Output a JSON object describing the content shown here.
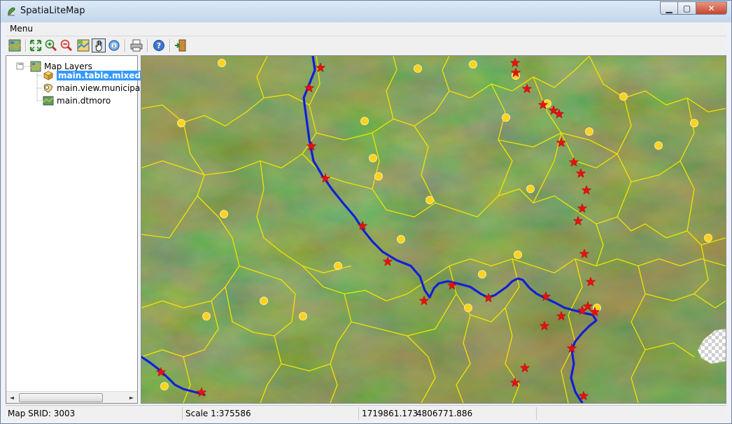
{
  "window": {
    "title": "SpatiaLiteMap",
    "min_glyph": "▁",
    "max_glyph": "▢",
    "close_glyph": "✕"
  },
  "menu": {
    "label": "Menu"
  },
  "toolbar": {
    "buttons": [
      {
        "name": "map-layers-icon"
      },
      {
        "name": "zoom-full-extent-icon"
      },
      {
        "name": "zoom-in-icon"
      },
      {
        "name": "zoom-out-icon"
      },
      {
        "name": "map-view-icon"
      },
      {
        "name": "pan-hand-icon",
        "active": true
      },
      {
        "name": "identify-icon"
      },
      {
        "name": "print-icon"
      },
      {
        "name": "help-icon"
      },
      {
        "name": "exit-icon"
      }
    ]
  },
  "tree": {
    "root_label": "Map Layers",
    "expander": "−",
    "layers": [
      {
        "label": "main.table.mixed",
        "selected": true
      },
      {
        "label": "main.view.municipal",
        "selected": false
      },
      {
        "label": "main.dtmoro",
        "selected": false
      }
    ]
  },
  "scroll": {
    "left_arrow": "◄",
    "right_arrow": "►"
  },
  "status": {
    "srid": "Map SRID: 3003",
    "scale": "Scale 1:375586",
    "x": "1719861.173",
    "y": "4806771.886"
  },
  "colors": {
    "river": "#1020d8",
    "boundary": "#f4e300",
    "point": "#ffd21e",
    "star": "#e81010",
    "selection": "#3399ff"
  }
}
